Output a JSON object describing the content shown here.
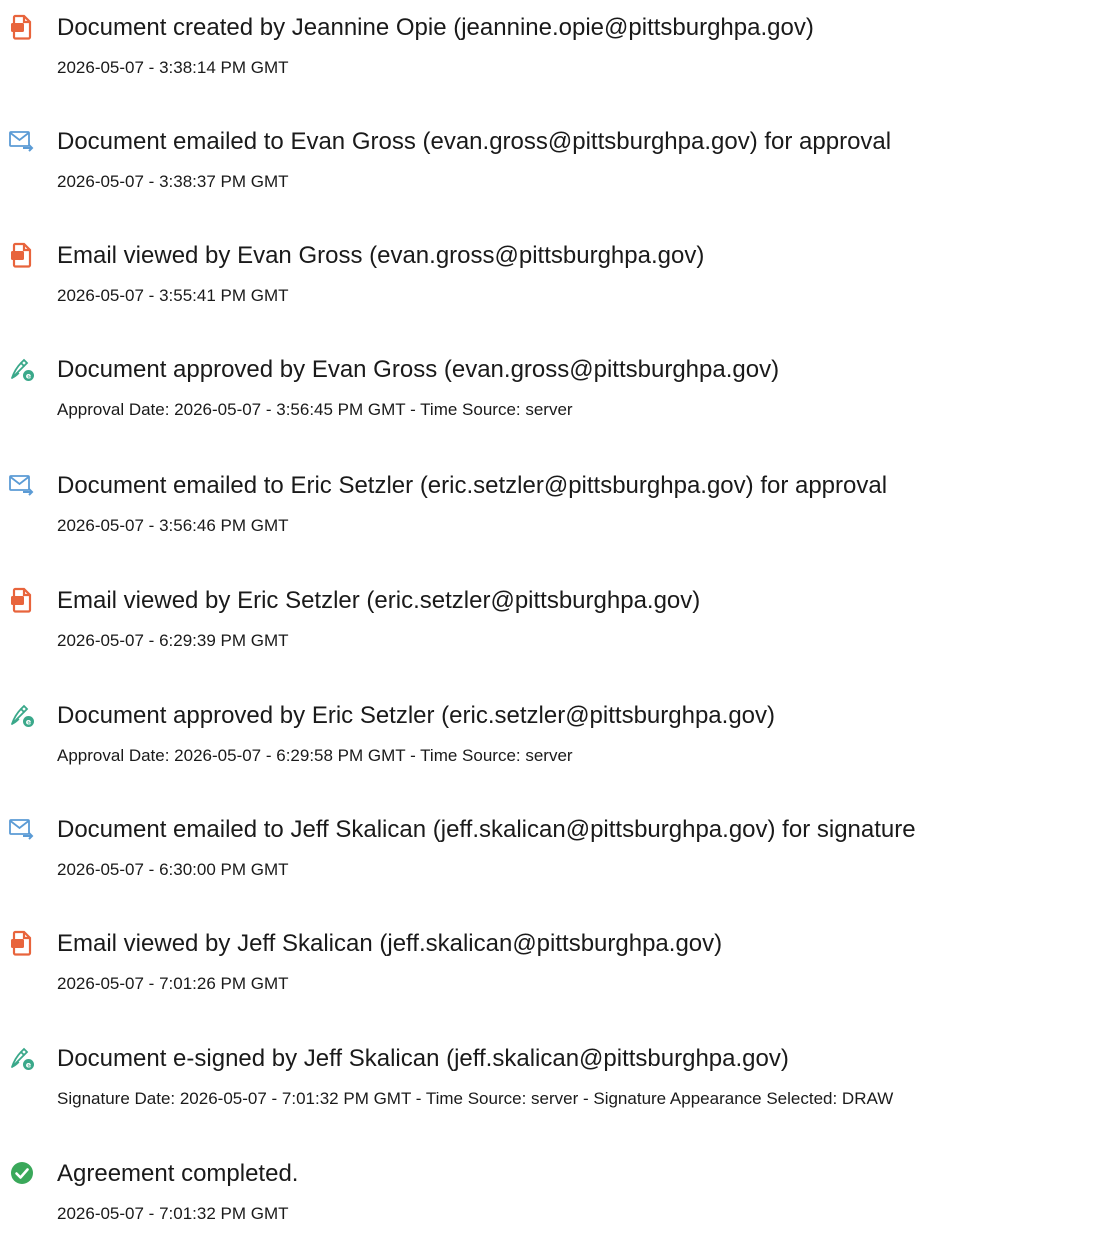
{
  "colors": {
    "doc_icon": "#e8643c",
    "email_icon": "#5b9bd5",
    "sign_icon": "#3aa88a",
    "check_icon": "#3aa85a",
    "text": "#1a1a1a"
  },
  "events": [
    {
      "icon": "document-icon",
      "title": "Document created by Jeannine Opie (jeannine.opie@pittsburghpa.gov)",
      "detail": "2026-05-07 - 3:38:14 PM GMT"
    },
    {
      "icon": "email-icon",
      "title": "Document emailed to Evan Gross (evan.gross@pittsburghpa.gov) for approval",
      "detail": "2026-05-07 - 3:38:37 PM GMT"
    },
    {
      "icon": "document-icon",
      "title": "Email viewed by Evan Gross (evan.gross@pittsburghpa.gov)",
      "detail": "2026-05-07 - 3:55:41 PM GMT"
    },
    {
      "icon": "pen-sign-icon",
      "title": "Document approved by Evan Gross (evan.gross@pittsburghpa.gov)",
      "detail": "Approval Date: 2026-05-07 - 3:56:45 PM GMT - Time Source: server"
    },
    {
      "icon": "email-icon",
      "title": "Document emailed to Eric Setzler (eric.setzler@pittsburghpa.gov) for approval",
      "detail": "2026-05-07 - 3:56:46 PM GMT"
    },
    {
      "icon": "document-icon",
      "title": "Email viewed by Eric Setzler (eric.setzler@pittsburghpa.gov)",
      "detail": "2026-05-07 - 6:29:39 PM GMT"
    },
    {
      "icon": "pen-sign-icon",
      "title": "Document approved by Eric Setzler (eric.setzler@pittsburghpa.gov)",
      "detail": "Approval Date: 2026-05-07 - 6:29:58 PM GMT - Time Source: server"
    },
    {
      "icon": "email-icon",
      "title": "Document emailed to Jeff Skalican (jeff.skalican@pittsburghpa.gov) for signature",
      "detail": "2026-05-07 - 6:30:00 PM GMT"
    },
    {
      "icon": "document-icon",
      "title": "Email viewed by Jeff Skalican (jeff.skalican@pittsburghpa.gov)",
      "detail": "2026-05-07 - 7:01:26 PM GMT"
    },
    {
      "icon": "pen-sign-icon",
      "title": "Document e-signed by Jeff Skalican (jeff.skalican@pittsburghpa.gov)",
      "detail": "Signature Date: 2026-05-07 - 7:01:32 PM GMT - Time Source: server - Signature Appearance Selected: DRAW"
    },
    {
      "icon": "check-circle-icon",
      "title": "Agreement completed.",
      "detail": "2026-05-07 - 7:01:32 PM GMT"
    }
  ]
}
